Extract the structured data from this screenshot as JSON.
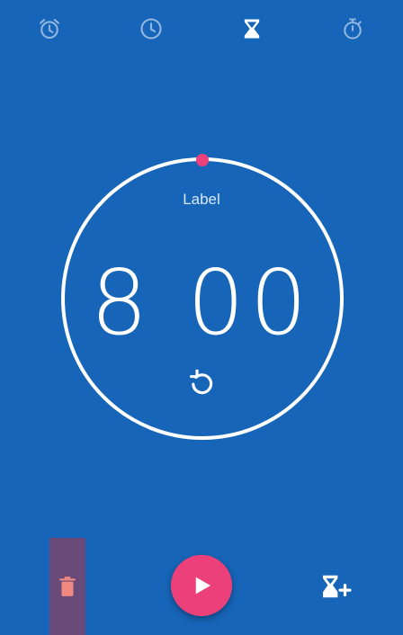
{
  "tabs": [
    {
      "name": "alarm",
      "icon": "alarm-icon",
      "active": false
    },
    {
      "name": "clock",
      "icon": "clock-icon",
      "active": false
    },
    {
      "name": "timer",
      "icon": "hourglass-icon",
      "active": true
    },
    {
      "name": "stopwatch",
      "icon": "stopwatch-icon",
      "active": false
    }
  ],
  "timer": {
    "label": "Label",
    "display": "8 00",
    "progress_fraction": 0
  },
  "actions": {
    "delete_icon": "trash-icon",
    "play_icon": "play-icon",
    "add_timer_icon": "add-timer-icon",
    "reset_icon": "reset-icon"
  },
  "colors": {
    "background": "#1765b8",
    "accent": "#ec407a",
    "ring": "#ffffff",
    "delete_highlight": "#6a4a78",
    "delete_icon": "#f08a80",
    "tab_inactive": "#8fb6e0"
  }
}
